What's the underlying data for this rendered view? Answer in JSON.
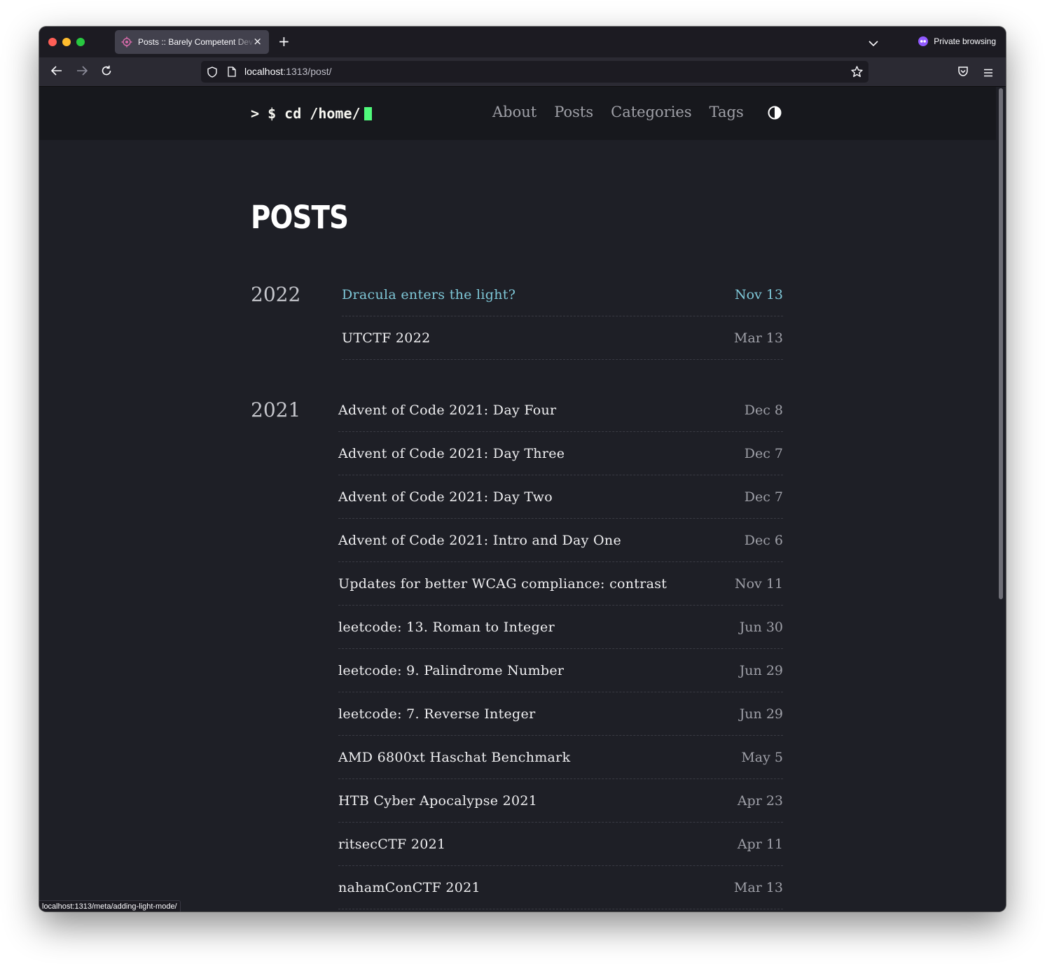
{
  "browser": {
    "tab_title": "Posts :: Barely Competent Dev — Mozilla Firefox Private Browsing",
    "new_tab_symbol": "+",
    "close_symbol": "×",
    "private_label": "Private browsing",
    "url_host": "localhost",
    "url_path": ":1313/post/",
    "status_url": "localhost:1313/meta/adding-light-mode/"
  },
  "site": {
    "logo_text": "> $ cd /home/",
    "nav": [
      "About",
      "Posts",
      "Categories",
      "Tags"
    ],
    "page_title": "POSTS"
  },
  "years": [
    {
      "year": "2022",
      "posts": [
        {
          "title": "Dracula enters the light?",
          "date": "Nov 13",
          "hover": true
        },
        {
          "title": "UTCTF 2022",
          "date": "Mar 13"
        }
      ]
    },
    {
      "year": "2021",
      "posts": [
        {
          "title": "Advent of Code 2021: Day Four",
          "date": "Dec 8"
        },
        {
          "title": "Advent of Code 2021: Day Three",
          "date": "Dec 7"
        },
        {
          "title": "Advent of Code 2021: Day Two",
          "date": "Dec 7"
        },
        {
          "title": "Advent of Code 2021: Intro and Day One",
          "date": "Dec 6"
        },
        {
          "title": "Updates for better WCAG compliance: contrast",
          "date": "Nov 11"
        },
        {
          "title": "leetcode: 13. Roman to Integer",
          "date": "Jun 30"
        },
        {
          "title": "leetcode: 9. Palindrome Number",
          "date": "Jun 29"
        },
        {
          "title": "leetcode: 7. Reverse Integer",
          "date": "Jun 29"
        },
        {
          "title": "AMD 6800xt Haschat Benchmark",
          "date": "May 5"
        },
        {
          "title": "HTB Cyber Apocalypse 2021",
          "date": "Apr 23"
        },
        {
          "title": "ritsecCTF 2021",
          "date": "Apr 11"
        },
        {
          "title": "nahamConCTF 2021",
          "date": "Mar 13"
        }
      ]
    }
  ],
  "colors": {
    "accent_hover": "#7fc8d8",
    "cursor": "#50fa7b",
    "background": "#1e1f26"
  }
}
